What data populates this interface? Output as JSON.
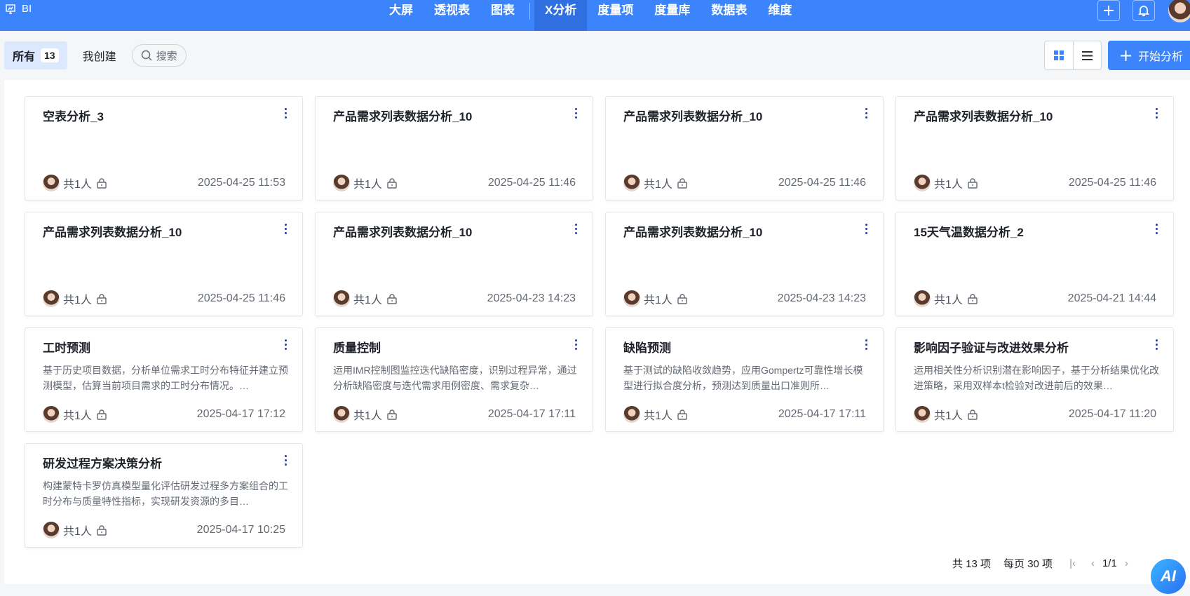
{
  "header": {
    "app_name": "BI",
    "nav": [
      "大屏",
      "透视表",
      "图表",
      "X分析",
      "度量项",
      "度量库",
      "数据表",
      "维度"
    ],
    "active_nav": "X分析"
  },
  "filter": {
    "all_label": "所有",
    "all_count": "13",
    "mine_label": "我创建",
    "search_placeholder": "搜索"
  },
  "toolbar": {
    "start_label": "开始分析"
  },
  "colors": {
    "primary": "#3b84fb"
  },
  "cards": [
    {
      "title": "空表分析_3",
      "desc": "",
      "members": "共1人",
      "date": "2025-04-25 11:53"
    },
    {
      "title": "产品需求列表数据分析_10",
      "desc": "",
      "members": "共1人",
      "date": "2025-04-25 11:46"
    },
    {
      "title": "产品需求列表数据分析_10",
      "desc": "",
      "members": "共1人",
      "date": "2025-04-25 11:46"
    },
    {
      "title": "产品需求列表数据分析_10",
      "desc": "",
      "members": "共1人",
      "date": "2025-04-25 11:46"
    },
    {
      "title": "产品需求列表数据分析_10",
      "desc": "",
      "members": "共1人",
      "date": "2025-04-25 11:46"
    },
    {
      "title": "产品需求列表数据分析_10",
      "desc": "",
      "members": "共1人",
      "date": "2025-04-23 14:23"
    },
    {
      "title": "产品需求列表数据分析_10",
      "desc": "",
      "members": "共1人",
      "date": "2025-04-23 14:23"
    },
    {
      "title": "15天气温数据分析_2",
      "desc": "",
      "members": "共1人",
      "date": "2025-04-21 14:44"
    },
    {
      "title": "工时预测",
      "desc": "基于历史项目数据，分析单位需求工时分布特征并建立预测模型，估算当前项目需求的工时分布情况。…",
      "members": "共1人",
      "date": "2025-04-17 17:12"
    },
    {
      "title": "质量控制",
      "desc": "运用IMR控制图监控迭代缺陷密度，识别过程异常，通过分析缺陷密度与迭代需求用例密度、需求复杂…",
      "members": "共1人",
      "date": "2025-04-17 17:11"
    },
    {
      "title": "缺陷预测",
      "desc": "基于测试的缺陷收敛趋势，应用Gompertz可靠性增长模型进行拟合度分析，预测达到质量出口准则所…",
      "members": "共1人",
      "date": "2025-04-17 17:11"
    },
    {
      "title": "影响因子验证与改进效果分析",
      "desc": "运用相关性分析识别潜在影响因子，基于分析结果优化改进策略，采用双样本t检验对改进前后的效果…",
      "members": "共1人",
      "date": "2025-04-17 11:20"
    },
    {
      "title": "研发过程方案决策分析",
      "desc": "构建蒙特卡罗仿真模型量化评估研发过程多方案组合的工时分布与质量特性指标，实现研发资源的多目…",
      "members": "共1人",
      "date": "2025-04-17 10:25"
    }
  ],
  "pagination": {
    "total": "共 13 项",
    "per_page": "每页 30 项",
    "page": "1/1"
  },
  "ai_button": "AI"
}
